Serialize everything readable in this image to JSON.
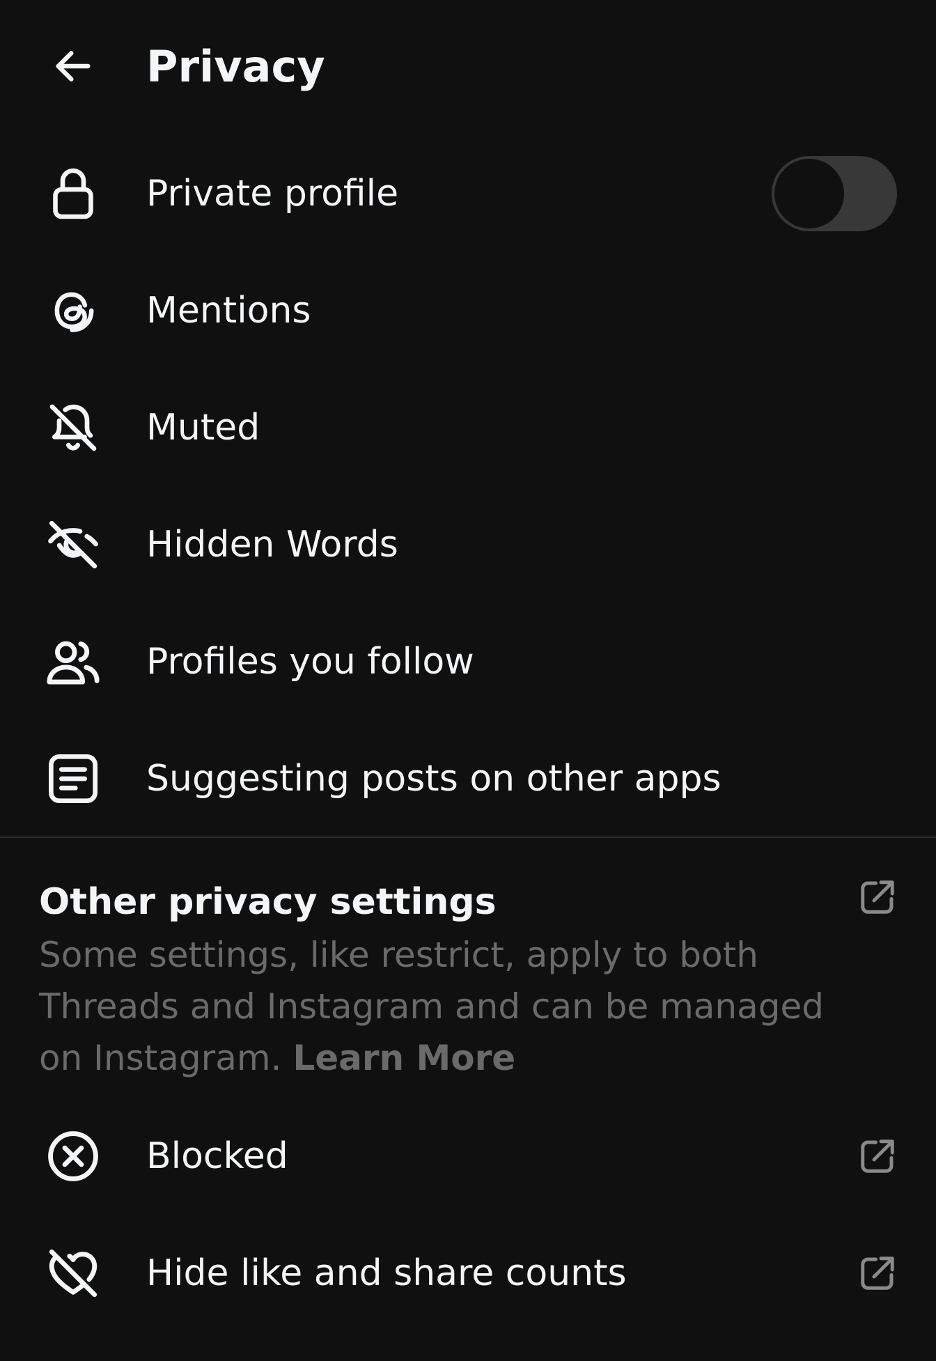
{
  "header": {
    "title": "Privacy",
    "back_icon": "arrow-left-icon"
  },
  "items": [
    {
      "label": "Private profile",
      "icon": "lock-icon",
      "toggle": {
        "on": false
      }
    },
    {
      "label": "Mentions",
      "icon": "threads-at-icon"
    },
    {
      "label": "Muted",
      "icon": "bell-off-icon"
    },
    {
      "label": "Hidden Words",
      "icon": "eye-off-icon"
    },
    {
      "label": "Profiles you follow",
      "icon": "people-icon"
    },
    {
      "label": "Suggesting posts on other apps",
      "icon": "document-icon"
    }
  ],
  "other_privacy": {
    "title": "Other privacy settings",
    "description": "Some settings, like restrict, apply to both Threads and Instagram and can be managed on Instagram.",
    "learn_more": "Learn More",
    "external_icon": "external-link-icon"
  },
  "external_items": [
    {
      "label": "Blocked",
      "icon": "circle-x-icon",
      "external_icon": "external-link-icon"
    },
    {
      "label": "Hide like and share counts",
      "icon": "heart-off-icon",
      "external_icon": "external-link-icon"
    }
  ],
  "colors": {
    "background": "#101010",
    "text": "#f3f5f7",
    "muted_text": "#6a6a6a",
    "toggle_track": "#383838",
    "divider": "#2b2b2b"
  }
}
